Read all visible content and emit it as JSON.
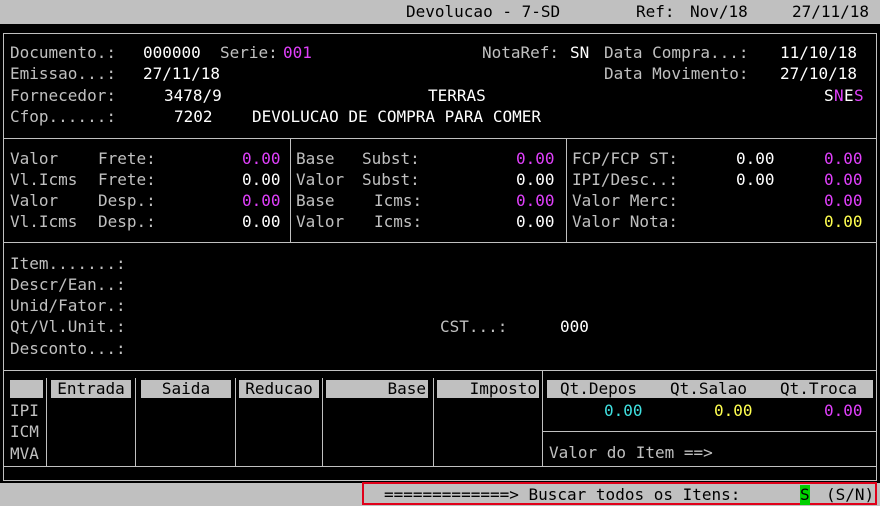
{
  "header": {
    "title": "Devolucao - 7-SD",
    "ref_label": "Ref:",
    "ref_value": "Nov/18",
    "date": "27/11/18"
  },
  "doc": {
    "documento_label": "Documento.:",
    "documento_value": "000000",
    "serie_label": "Serie:",
    "serie_value": "001",
    "notaref_label": "NotaRef:",
    "notaref_value": "SN",
    "data_compra_label": "Data Compra...:",
    "data_compra_value": "11/10/18",
    "emissao_label": "Emissao...:",
    "emissao_value": "27/11/18",
    "data_mov_label": "Data Movimento:",
    "data_mov_value": "27/10/18",
    "fornecedor_label": "Fornecedor:",
    "fornecedor_value": "3478/9",
    "fornecedor_name": "TERRAS",
    "sne_s": "S",
    "sne_n": "N",
    "sne_e": "E",
    "sne_s2": "S",
    "cfop_label": "Cfop......:",
    "cfop_value": "7202",
    "cfop_desc": "DEVOLUCAO DE COMPRA PARA COMER"
  },
  "totals": {
    "left": [
      {
        "a": "Valor",
        "b": "Frete:",
        "v": "0.00",
        "color": "m"
      },
      {
        "a": "Vl.Icms",
        "b": "Frete:",
        "v": "0.00",
        "color": "w"
      },
      {
        "a": "Valor",
        "b": "Desp.:",
        "v": "0.00",
        "color": "m"
      },
      {
        "a": "Vl.Icms",
        "b": "Desp.:",
        "v": "0.00",
        "color": "w"
      }
    ],
    "middle": [
      {
        "a": "Base",
        "b": "Subst:",
        "v": "0.00",
        "color": "m"
      },
      {
        "a": "Valor",
        "b": "Subst:",
        "v": "0.00",
        "color": "w"
      },
      {
        "a": "Base",
        "b": "Icms:",
        "v": "0.00",
        "color": "m"
      },
      {
        "a": "Valor",
        "b": "Icms:",
        "v": "0.00",
        "color": "w"
      }
    ],
    "right": {
      "fcp_label": "FCP/FCP ST:",
      "fcp_v1": "0.00",
      "fcp_v2": "0.00",
      "ipi_label": "IPI/Desc..:",
      "ipi_v1": "0.00",
      "ipi_v2": "0.00",
      "merc_label": "Valor Merc:",
      "merc_v": "0.00",
      "nota_label": "Valor Nota:",
      "nota_v": "0.00"
    }
  },
  "item": {
    "item_label": "Item.......:",
    "descr_label": "Descr/Ean..:",
    "unid_label": "Unid/Fator.:",
    "qt_label": "Qt/Vl.Unit.:",
    "cst_label": "CST...:",
    "cst_value": "000",
    "desconto_label": "Desconto...:"
  },
  "taxtable": {
    "headers": [
      "Entrada",
      "Saida",
      "Reducao",
      "Base",
      "Imposto"
    ],
    "rows": [
      "IPI",
      "ICM",
      "MVA"
    ]
  },
  "qty": {
    "headers": [
      "Qt.Depos",
      "Qt.Salao",
      "Qt.Troca"
    ],
    "values": [
      "0.00",
      "0.00",
      "0.00"
    ],
    "valor_item_label": "Valor do Item ==>"
  },
  "status": {
    "prompt": "=============> Buscar todos os Itens:",
    "answer": "S",
    "options": "(S/N)"
  }
}
